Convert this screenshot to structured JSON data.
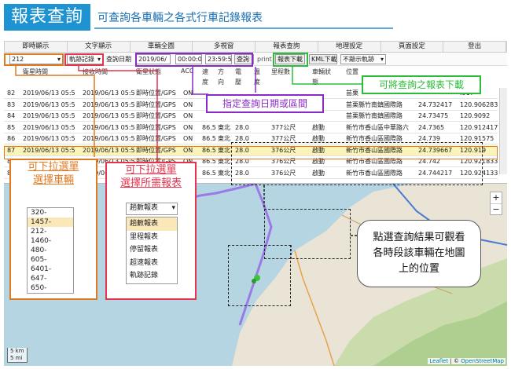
{
  "header": {
    "badge": "報表查詢",
    "subtitle": "可查詢各車輛之各式行車記錄報表"
  },
  "nav": [
    "即時顯示",
    "文字顯示",
    "車輛全圖",
    "多視窗",
    "報表查詢",
    "地理設定",
    "頁面設定",
    "登出"
  ],
  "toolbar": {
    "vehicle": "212",
    "report": "軌跡記錄",
    "date_label": "查詢日期",
    "date": "2019/06/",
    "time_start": "00:00:0",
    "time_end": "23:59:5",
    "query": "查詢",
    "print": "print",
    "report_download": "報表下載",
    "kml_download": "KML下載",
    "display_select": "不顯示軌跡"
  },
  "table": {
    "headers": [
      "衛星時間",
      "接收時間",
      "衛星狀態",
      "ACC",
      "速",
      "方",
      "電",
      "溫",
      "里程數",
      "車輛狀",
      "位置"
    ],
    "headers_row2": [
      "度",
      "向",
      "壓",
      "度",
      "態"
    ],
    "rows": [
      {
        "id": "82",
        "gps_time": "2019/06/13 05:5",
        "recv_time": "2019/06/13 05:5",
        "status": "即時位置/GPS",
        "acc": "ON",
        "speed": "",
        "dir": "",
        "volt": "",
        "temp": "",
        "mileage": "",
        "state": "",
        "location": "苗栗",
        "lat": "",
        "lng": ".917"
      },
      {
        "id": "83",
        "gps_time": "2019/06/13 05:5",
        "recv_time": "2019/06/13 05:5",
        "status": "即時位置/GPS",
        "acc": "ON",
        "speed": "",
        "dir": "",
        "volt": "",
        "temp": "",
        "mileage": "",
        "state": "",
        "location": "苗栗縣竹南鎮國際路",
        "lat": "24.732417",
        "lng": "120.906283"
      },
      {
        "id": "84",
        "gps_time": "2019/06/13 05:5",
        "recv_time": "2019/06/13 05:5",
        "status": "即時位置/GPS",
        "acc": "ON",
        "speed": "",
        "dir": "",
        "volt": "",
        "temp": "",
        "mileage": "",
        "state": "",
        "location": "苗栗縣竹南鎮國際路",
        "lat": "24.73475",
        "lng": "120.9092"
      },
      {
        "id": "85",
        "gps_time": "2019/06/13 05:5",
        "recv_time": "2019/06/13 05:5",
        "status": "即時位置/GPS",
        "acc": "ON",
        "speed": "86.5",
        "dir": "東北",
        "volt": "28.0",
        "temp": "",
        "mileage": "377公尺",
        "state": "啟動",
        "location": "新竹市香山區中華路六",
        "lat": "24.7365",
        "lng": "120.912417"
      },
      {
        "id": "86",
        "gps_time": "2019/06/13 05:5",
        "recv_time": "2019/06/13 05:5",
        "status": "即時位置/GPS",
        "acc": "ON",
        "speed": "86.5",
        "dir": "東北",
        "volt": "28.0",
        "temp": "",
        "mileage": "377公尺",
        "state": "啟動",
        "location": "新竹市香山區國際路",
        "lat": "24.739",
        "lng": "120.91575"
      },
      {
        "id": "87",
        "gps_time": "2019/06/13 05:5",
        "recv_time": "2019/06/13 05:5",
        "status": "即時位置/GPS",
        "acc": "ON",
        "speed": "86.5",
        "dir": "東北",
        "volt": "28.0",
        "temp": "",
        "mileage": "376公尺",
        "state": "啟動",
        "location": "新竹市香山區國際路",
        "lat": "24.739667",
        "lng": "120.919"
      },
      {
        "id": "88",
        "gps_time": "2019/06/13 05:5",
        "recv_time": "2019/06/13 05:5",
        "status": "即時位置/GPS",
        "acc": "ON",
        "speed": "86.5",
        "dir": "東北",
        "volt": "28.0",
        "temp": "",
        "mileage": "376公尺",
        "state": "啟動",
        "location": "新竹市香山區國際路",
        "lat": "24.742",
        "lng": "120.921833"
      },
      {
        "id": "89",
        "gps_time": "2019/06/13 05:5",
        "recv_time": "2019/06/13 05:5",
        "status": "即時位置/GPS",
        "acc": "ON",
        "speed": "86.5",
        "dir": "東北",
        "volt": "28.0",
        "temp": "",
        "mileage": "376公尺",
        "state": "啟動",
        "location": "新竹市香山區國際路",
        "lat": "24.744217",
        "lng": "120.924133"
      }
    ]
  },
  "annotations": {
    "date_range": "指定查詢日期或區間",
    "download": "可將查詢之報表下載",
    "vehicle_title": "可下拉選單\n選擇車輛",
    "report_title": "可下拉選單\n選擇所需報表",
    "map_hint": "點選查詢結果可觀看\n各時段該車輛在地圖\n上的位置"
  },
  "vehicle_list": [
    "320-",
    "1457-",
    "212-",
    "1460-",
    "480-",
    "605-",
    "6401-",
    "647-",
    "650-"
  ],
  "report_list": {
    "selected": "趟數報表",
    "items": [
      "趟數報表",
      "里程報表",
      "停留報表",
      "超速報表",
      "軌跡記錄"
    ]
  },
  "map": {
    "zoom_in": "+",
    "zoom_out": "−",
    "scale_km": "5 km",
    "scale_mi": "5 mi",
    "attribution_leaflet": "Leaflet",
    "attribution_sep": " | © ",
    "attribution_osm": "OpenStreetMap"
  },
  "colors": {
    "orange": "#e07a22",
    "red": "#e6334e",
    "purple": "#8a2ac8",
    "green": "#2bbd3a",
    "blue": "#1e93d2",
    "highlight": "#fbf3b8"
  }
}
